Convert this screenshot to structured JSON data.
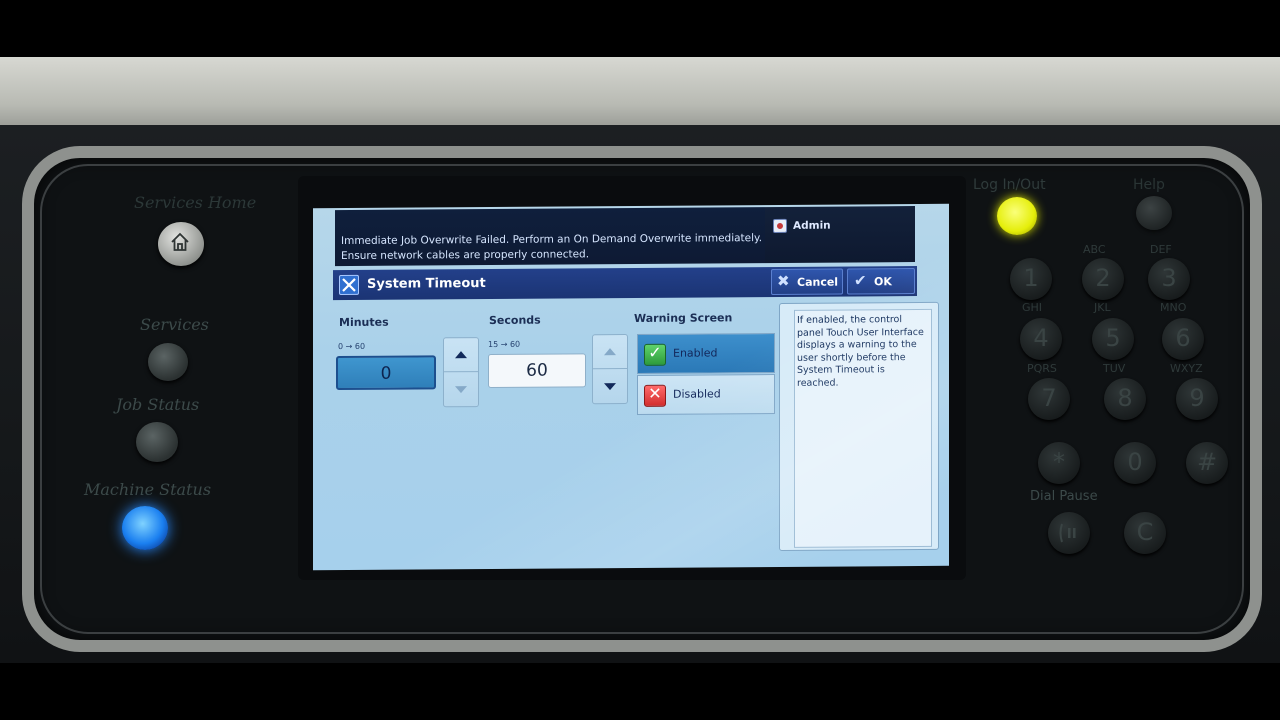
{
  "panel": {
    "left_buttons": {
      "services_home": "Services Home",
      "services": "Services",
      "job_status": "Job Status",
      "machine_status": "Machine Status"
    },
    "right_buttons": {
      "log_in_out": "Log In/Out",
      "help": "Help",
      "dial_pause": "Dial Pause"
    },
    "keypad": {
      "letters": [
        "ABC",
        "DEF",
        "GHI",
        "JKL",
        "MNO",
        "PQRS",
        "TUV",
        "WXYZ"
      ],
      "digits": [
        "1",
        "2",
        "3",
        "4",
        "5",
        "6",
        "7",
        "8",
        "9",
        "*",
        "0",
        "#",
        "C"
      ]
    }
  },
  "screen": {
    "message": {
      "line1": "Immediate Job Overwrite Failed.  Perform an On Demand Overwrite immediately.",
      "line2": "Ensure network cables are properly connected."
    },
    "user": "Admin",
    "dialog": {
      "title": "System Timeout",
      "cancel_label": "Cancel",
      "ok_label": "OK",
      "minutes": {
        "label": "Minutes",
        "range": "0 → 60",
        "value": "0"
      },
      "seconds": {
        "label": "Seconds",
        "range": "15 → 60",
        "value": "60"
      },
      "warning_screen": {
        "label": "Warning Screen",
        "options": [
          "Enabled",
          "Disabled"
        ],
        "selected": "Enabled"
      },
      "help_text": "If enabled, the control panel Touch User Interface displays a warning to the user shortly before the System Timeout is reached."
    }
  },
  "colors": {
    "screen_bg": "#aad1ea",
    "titlebar": "#1b3474",
    "selected": "#2f7fb9",
    "machine_status_led": "#1a7ff0",
    "log_in_led": "#e5ee0a"
  }
}
